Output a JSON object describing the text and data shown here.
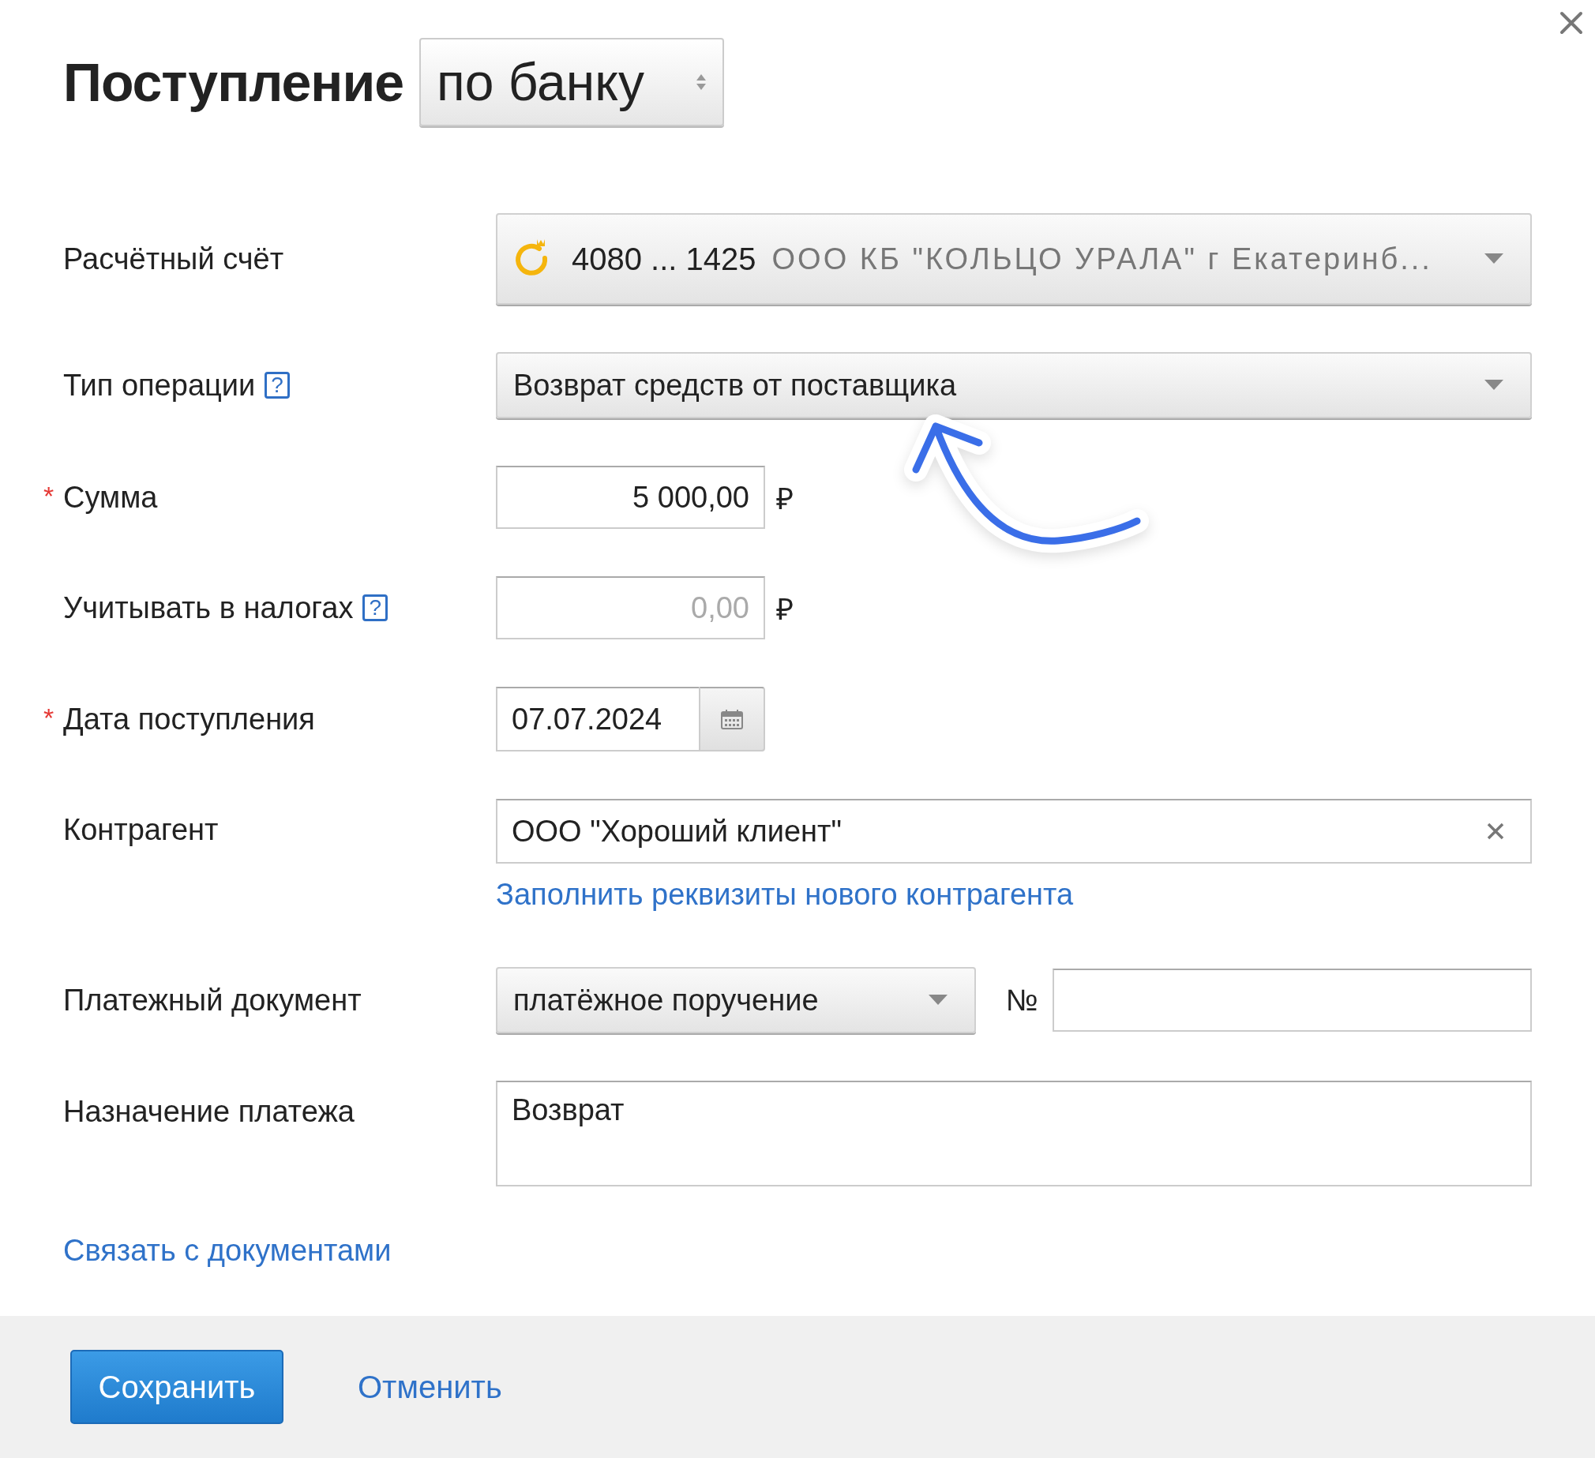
{
  "title": "Поступление",
  "mode_select": {
    "value": "по банку"
  },
  "fields": [
    {
      "kind": "account",
      "label": "Расчётный счёт",
      "number": "4080 ... 1425",
      "bank": "ООО КБ \"КОЛЬЦО УРАЛА\" г Екатеринб..."
    },
    {
      "kind": "select",
      "label": "Тип операции",
      "help": "?",
      "value": "Возврат средств от поставщика"
    },
    {
      "kind": "money",
      "label": "Сумма",
      "required_mark": "*",
      "value": "5 000,00",
      "currency": "₽"
    },
    {
      "kind": "money",
      "label": "Учитывать в налогах",
      "help": "?",
      "placeholder": "0,00",
      "currency": "₽"
    },
    {
      "kind": "date",
      "label": "Дата поступления",
      "required_mark": "*",
      "value": "07.07.2024"
    },
    {
      "kind": "counterparty",
      "label": "Контрагент",
      "value": "ООО \"Хороший клиент\"",
      "link": "Заполнить реквизиты нового контрагента"
    },
    {
      "kind": "payment_doc",
      "label": "Платежный документ",
      "value": "платёжное поручение",
      "number_label": "№"
    },
    {
      "kind": "textarea",
      "label": "Назначение платежа",
      "value": "Возврат"
    }
  ],
  "link_documents": "Связать с документами",
  "footer": {
    "save": "Сохранить",
    "cancel": "Отменить"
  }
}
